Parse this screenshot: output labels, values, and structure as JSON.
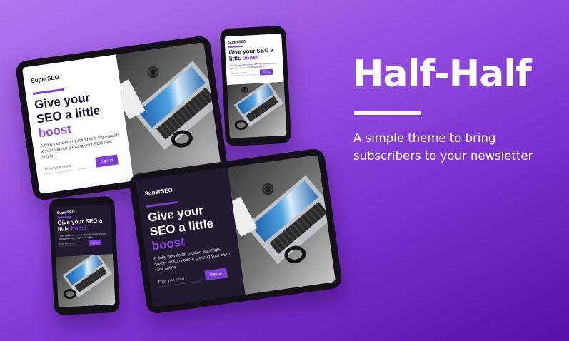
{
  "hero": {
    "title": "Half-Half",
    "subtitle": "A simple theme to bring subscribers to your newsletter"
  },
  "mockup": {
    "brand": "SuperSEO",
    "headline_part1": "Give your SEO a",
    "headline_part2": "little",
    "headline_highlight": "boost",
    "description": "A daily newsletter packed with high-quality lessons about growing your SEO rank online.",
    "email_placeholder": "Enter your email",
    "signup_label": "Sign up"
  },
  "colors": {
    "background_top": "#b276ee",
    "background_bottom": "#5a0fa6",
    "accent": "#7c3fd0",
    "highlight": "#8b47e8",
    "dark_panel": "#221a30"
  }
}
